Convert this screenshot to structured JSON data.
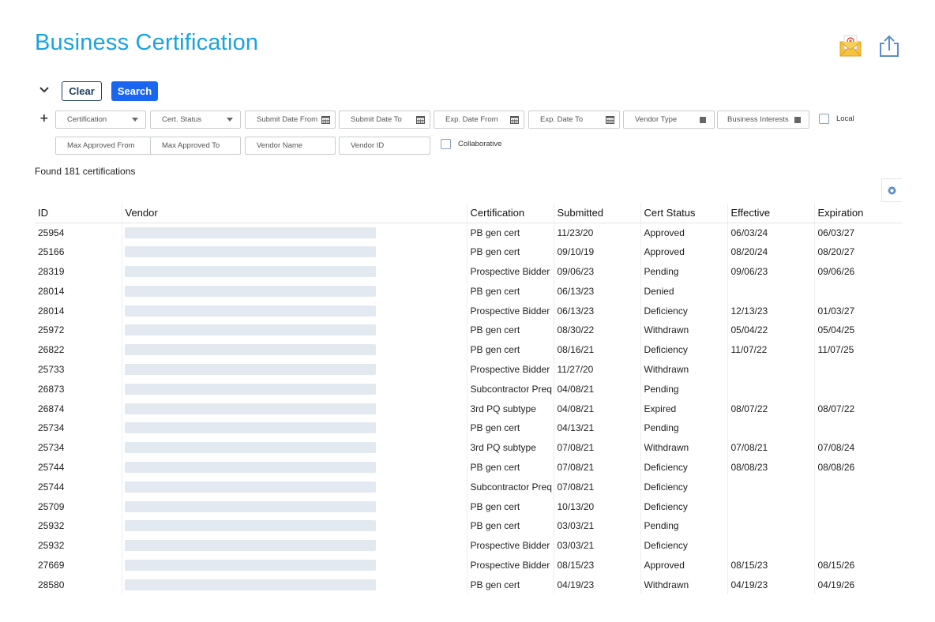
{
  "page": {
    "title": "Business Certification"
  },
  "header_icons": {
    "email": "email-envelope-icon",
    "share": "share-export-icon"
  },
  "toolbar": {
    "clear_label": "Clear",
    "search_label": "Search"
  },
  "filters": {
    "certification": "Certification",
    "cert_status": "Cert. Status",
    "submit_date_from": "Submit Date From",
    "submit_date_to": "Submit Date To",
    "exp_date_from": "Exp. Date From",
    "exp_date_to": "Exp. Date To",
    "vendor_type": "Vendor Type",
    "business_interests": "Business Interests",
    "local": "Local",
    "max_approved_from": "Max Approved From",
    "max_approved_to": "Max Approved To",
    "vendor_name": "Vendor Name",
    "vendor_id": "Vendor ID",
    "collaborative": "Collaborative"
  },
  "results": {
    "found_text": "Found 181 certifications"
  },
  "table": {
    "columns": [
      "ID",
      "Vendor",
      "Certification",
      "Submitted",
      "Cert Status",
      "Effective",
      "Expiration"
    ],
    "rows": [
      [
        "25954",
        "",
        "PB gen cert",
        "11/23/20",
        "Approved",
        "06/03/24",
        "06/03/27"
      ],
      [
        "25166",
        "",
        "PB gen cert",
        "09/10/19",
        "Approved",
        "08/20/24",
        "08/20/27"
      ],
      [
        "28319",
        "",
        "Prospective Bidder",
        "09/06/23",
        "Pending",
        "09/06/23",
        "09/06/26"
      ],
      [
        "28014",
        "",
        "PB gen cert",
        "06/13/23",
        "Denied",
        "",
        ""
      ],
      [
        "28014",
        "",
        "Prospective Bidder",
        "06/13/23",
        "Deficiency",
        "12/13/23",
        "01/03/27"
      ],
      [
        "25972",
        "",
        "PB gen cert",
        "08/30/22",
        "Withdrawn",
        "05/04/22",
        "05/04/25"
      ],
      [
        "26822",
        "",
        "PB gen cert",
        "08/16/21",
        "Deficiency",
        "11/07/22",
        "11/07/25"
      ],
      [
        "25733",
        "",
        "Prospective Bidder",
        "11/27/20",
        "Withdrawn",
        "",
        ""
      ],
      [
        "26873",
        "",
        "Subcontractor Preq",
        "04/08/21",
        "Pending",
        "",
        ""
      ],
      [
        "26874",
        "",
        "3rd PQ subtype",
        "04/08/21",
        "Expired",
        "08/07/22",
        "08/07/22"
      ],
      [
        "25734",
        "",
        "PB gen cert",
        "04/13/21",
        "Pending",
        "",
        ""
      ],
      [
        "25734",
        "",
        "3rd PQ subtype",
        "07/08/21",
        "Withdrawn",
        "07/08/21",
        "07/08/24"
      ],
      [
        "25744",
        "",
        "PB gen cert",
        "07/08/21",
        "Deficiency",
        "08/08/23",
        "08/08/26"
      ],
      [
        "25744",
        "",
        "Subcontractor Preq",
        "07/08/21",
        "Deficiency",
        "",
        ""
      ],
      [
        "25709",
        "",
        "PB gen cert",
        "10/13/20",
        "Deficiency",
        "",
        ""
      ],
      [
        "25932",
        "",
        "PB gen cert",
        "03/03/21",
        "Pending",
        "",
        ""
      ],
      [
        "25932",
        "",
        "Prospective Bidder",
        "03/03/21",
        "Deficiency",
        "",
        ""
      ],
      [
        "27669",
        "",
        "Prospective Bidder",
        "08/15/23",
        "Approved",
        "08/15/23",
        "08/15/26"
      ],
      [
        "28580",
        "",
        "PB gen cert",
        "04/19/23",
        "Withdrawn",
        "04/19/23",
        "04/19/26"
      ]
    ]
  },
  "colors": {
    "title": "#1aa3e0",
    "search_button": "#1a66f0",
    "clear_border": "#1f3f66",
    "redacted_bar": "#e3e9f0"
  }
}
